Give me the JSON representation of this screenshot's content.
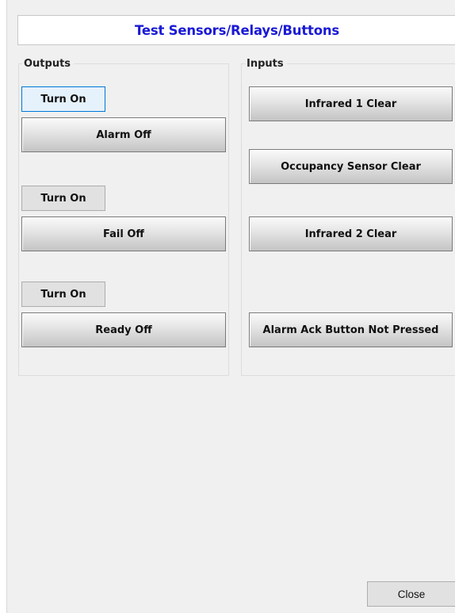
{
  "title": "Test Sensors/Relays/Buttons",
  "outputs": {
    "label": "Outputs",
    "items": [
      {
        "toggle_label": "Turn On",
        "status": "Alarm Off"
      },
      {
        "toggle_label": "Turn On",
        "status": "Fail Off"
      },
      {
        "toggle_label": "Turn On",
        "status": "Ready Off"
      }
    ]
  },
  "inputs": {
    "label": "Inputs",
    "items": [
      "Infrared 1 Clear",
      "Occupancy Sensor Clear",
      "Infrared 2 Clear",
      "Alarm Ack Button Not Pressed"
    ]
  },
  "close_label": "Close",
  "colors": {
    "title": "#1a1ad6",
    "background": "#f0f0f0",
    "focus_border": "#0078d7"
  }
}
